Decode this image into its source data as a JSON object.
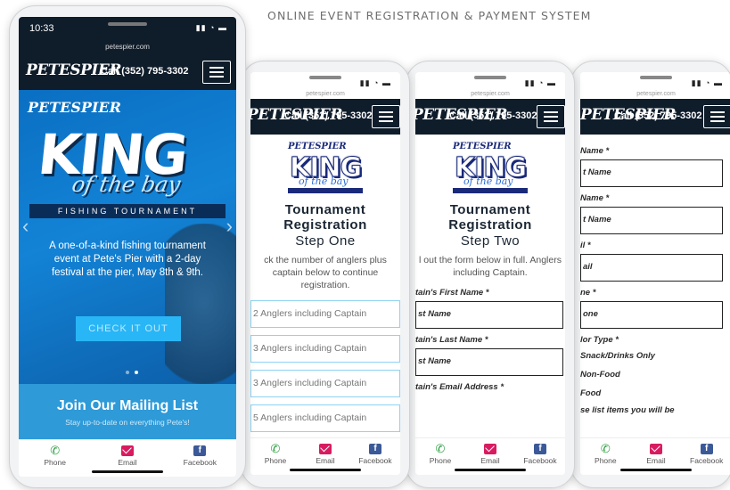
{
  "headline": "ONLINE EVENT REGISTRATION & PAYMENT SYSTEM",
  "status": {
    "time": "10:33",
    "url": "petespier.com"
  },
  "site": {
    "logo": "PETESPIER",
    "phone": "Call (352) 795-3302"
  },
  "hero": {
    "script": "PETESPIER",
    "title": "KING",
    "subtitle": "of the bay",
    "banner": "FISHING TOURNAMENT",
    "text": "A one-of-a-kind fishing tournament event at Pete's Pier with a 2-day festival at the pier, May 8th & 9th.",
    "cta": "CHECK IT OUT",
    "prev": "‹",
    "next": "›"
  },
  "mailing": {
    "title": "Join Our Mailing List",
    "text": "Stay up-to-date on everything Pete's!"
  },
  "nav": {
    "phone": "Phone",
    "email": "Email",
    "facebook": "Facebook"
  },
  "logo_small": {
    "script": "PETESPIER",
    "king": "KING",
    "bay": "of the bay"
  },
  "step1": {
    "title_line1": "Tournament",
    "title_line2": "Registration",
    "step": "Step One",
    "desc": "ck the number of anglers plus captain below to continue registration.",
    "options": [
      "2 Anglers including Captain",
      "3 Anglers including Captain",
      "3 Anglers including Captain",
      "5 Anglers including Captain"
    ]
  },
  "step2": {
    "title_line1": "Tournament",
    "title_line2": "Registration",
    "step": "Step Two",
    "desc": "l out the form below in full. Anglers including Captain.",
    "first_label": "tain's First Name *",
    "first_ph": "st Name",
    "last_label": "tain's Last Name *",
    "last_ph": "st Name",
    "email_label": "tain's Email Address *"
  },
  "step3": {
    "l1": "Name *",
    "p1": "t Name",
    "l2": "Name *",
    "p2": "t Name",
    "l3": "il *",
    "p3": "ail",
    "l4": "ne *",
    "p4": "one",
    "l5": "lor Type *",
    "v1": "Snack/Drinks Only",
    "v2": "Non-Food",
    "v3": "Food",
    "v4": "se list items you will be"
  }
}
